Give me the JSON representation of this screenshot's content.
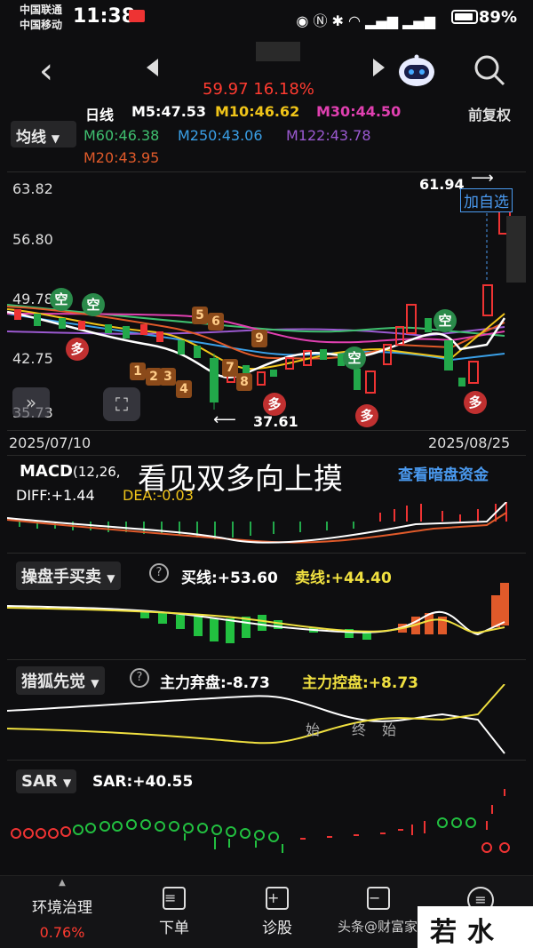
{
  "status": {
    "carrier1": "中国联通",
    "carrier2": "中国移动",
    "time": "11:38",
    "battery": "89%",
    "battery_level": 0.89
  },
  "header": {
    "quote": "59.97 16.18%"
  },
  "ma": {
    "period_label": "日线",
    "fq_label": "前复权",
    "button": "均线",
    "m5": "M5:47.53",
    "m10": "M10:46.62",
    "m30": "M30:44.50",
    "m60": "M60:46.38",
    "m250": "M250:43.06",
    "m122": "M122:43.78",
    "m20": "M20:43.95",
    "colors": {
      "m5": "#ffffff",
      "m10": "#f0c419",
      "m30": "#e040b0",
      "m60": "#3fbf6f",
      "m250": "#3aa0e8",
      "m122": "#9b59d0",
      "m20": "#e05a2a"
    }
  },
  "kchart": {
    "y_labels": [
      "63.82",
      "56.80",
      "49.78",
      "42.75",
      "35.73"
    ],
    "high_label": "61.94",
    "low_label": "37.61",
    "add_watch": "加自选",
    "date_start": "2025/07/10",
    "date_end": "2025/08/25",
    "signal_kong": "空",
    "signal_duo": "多",
    "numbers": [
      "1",
      "2",
      "3",
      "4",
      "5",
      "6",
      "7",
      "8",
      "9"
    ]
  },
  "macd": {
    "title": "MACD",
    "params": "(12,26,",
    "diff": "DIFF:+1.44",
    "dea": "DEA:-0.03",
    "link": "查看暗盘资金"
  },
  "overlay_text": "看见双多向上摸",
  "caopan": {
    "button": "操盘手买卖",
    "buy": "买线:+53.60",
    "sell": "卖线:+44.40"
  },
  "liehu": {
    "button": "猎狐先觉",
    "abandon": "主力弃盘:-8.73",
    "control": "主力控盘:+8.73",
    "marks": [
      "始",
      "终",
      "始"
    ]
  },
  "sar": {
    "button": "SAR",
    "value": "SAR:+40.55"
  },
  "bottom_nav": {
    "env": "环境治理",
    "env_pct": "0.76%",
    "order": "下单",
    "diagnose": "诊股",
    "more_label": "头条@",
    "watermark_user": "财富家",
    "logo": "若水网"
  }
}
